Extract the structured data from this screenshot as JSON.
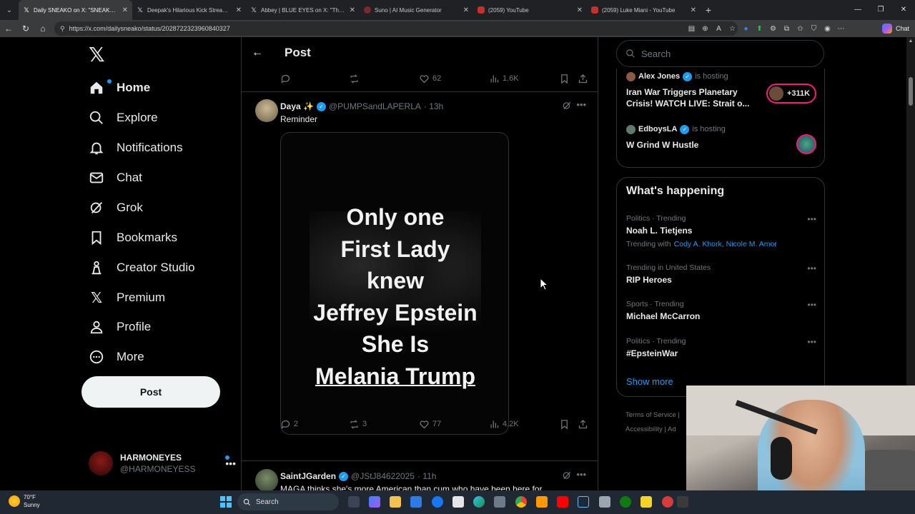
{
  "browser": {
    "tabs": [
      {
        "title": "Daily SNEAKO on X: \"SNEAKO says",
        "favicon": "x-icon",
        "active": true
      },
      {
        "title": "Deepak's Hilarious Kick Streaming",
        "favicon": "x-icon",
        "active": false
      },
      {
        "title": "Abbey | BLUE EYES on X: \"The Pizz",
        "favicon": "x-icon",
        "active": false
      },
      {
        "title": "Suno | AI Music Generator",
        "favicon": "suno-icon",
        "active": false
      },
      {
        "title": "(2059) YouTube",
        "favicon": "youtube-icon",
        "active": false
      },
      {
        "title": "(2059) Luke Miani - YouTube",
        "favicon": "youtube-icon",
        "active": false
      }
    ],
    "url": "https://x.com/dailysneako/status/2028722323960840327",
    "chat_label": "Chat"
  },
  "nav": {
    "items": [
      {
        "label": "Home",
        "icon": "home-icon"
      },
      {
        "label": "Explore",
        "icon": "search-icon"
      },
      {
        "label": "Notifications",
        "icon": "bell-icon"
      },
      {
        "label": "Chat",
        "icon": "mail-icon"
      },
      {
        "label": "Grok",
        "icon": "grok-icon"
      },
      {
        "label": "Bookmarks",
        "icon": "bookmark-icon"
      },
      {
        "label": "Creator Studio",
        "icon": "creator-icon"
      },
      {
        "label": "Premium",
        "icon": "x-logo-icon"
      },
      {
        "label": "Profile",
        "icon": "person-icon"
      },
      {
        "label": "More",
        "icon": "more-circle-icon"
      }
    ],
    "post_button": "Post",
    "account": {
      "name": "HARMONEYES",
      "handle": "@HARMONEYESS"
    }
  },
  "post_header": {
    "title": "Post"
  },
  "main_stats": {
    "likes": "62",
    "views": "1.6K"
  },
  "reply1": {
    "name": "Daya ✨",
    "handle": "@PUMPSandLAPERLA",
    "time": "· 13h",
    "text": "Reminder",
    "image_lines": [
      "Only one",
      "First Lady",
      "knew",
      "Jeffrey Epstein",
      "She Is",
      "Melania Trump"
    ],
    "stats": {
      "replies": "2",
      "reposts": "3",
      "likes": "77",
      "views": "4.2K"
    }
  },
  "reply2": {
    "name": "SaintJGarden",
    "handle": "@JStJ84622025",
    "time": "· 11h",
    "text": "MAGA thinks she's more American than cum who have been here for"
  },
  "search": {
    "placeholder": "Search"
  },
  "spaces": [
    {
      "host": "Alex Jones",
      "hosting_label": "is hosting",
      "title": "Iran War Triggers Planetary Crisis! WATCH LIVE: Strait o...",
      "listeners": "+311K"
    },
    {
      "host": "EdboysLA",
      "hosting_label": "is hosting",
      "title": "W Grind W Hustle"
    }
  ],
  "happening": {
    "title": "What's happening",
    "trends": [
      {
        "context": "Politics · Trending",
        "name": "Noah L. Tietjens",
        "with_label": "Trending with",
        "with": "Cody A. Khork, Nicole M. Amor"
      },
      {
        "context": "Trending in United States",
        "name": "RIP Heroes"
      },
      {
        "context": "Sports · Trending",
        "name": "Michael McCarron"
      },
      {
        "context": "Politics · Trending",
        "name": "#EpsteinWar"
      }
    ],
    "show_more": "Show more"
  },
  "footer": {
    "terms": "Terms of Service",
    "accessibility": "Accessibility",
    "sep": "|",
    "ad_fragment": "Ad"
  },
  "taskbar": {
    "temp": "70°F",
    "condition": "Sunny",
    "search_label": "Search"
  }
}
